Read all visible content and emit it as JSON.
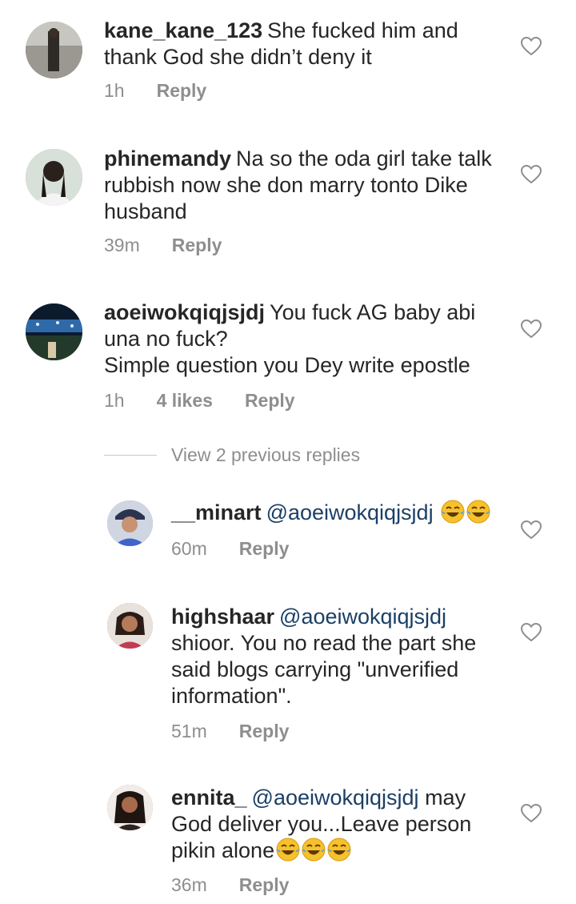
{
  "comments": [
    {
      "username": "kane_kane_123",
      "text": "She fucked him and thank God she didn’t deny it",
      "time": "1h",
      "reply_label": "Reply"
    },
    {
      "username": "phinemandy",
      "text": "Na so the oda girl take talk rubbish now she don marry tonto Dike husband",
      "time": "39m",
      "reply_label": "Reply"
    },
    {
      "username": "aoeiwokqiqjsjdj",
      "text_line1": "You fuck AG baby abi una no fuck?",
      "text_line2": "Simple question you Dey write epostle",
      "time": "1h",
      "likes": "4 likes",
      "reply_label": "Reply"
    }
  ],
  "view_previous_replies": "View 2 previous replies",
  "replies": [
    {
      "username": "__minart",
      "mention": "@aoeiwokqiqjsjdj",
      "text": "",
      "emoji_count": 2,
      "time": "60m",
      "reply_label": "Reply"
    },
    {
      "username": "highshaar",
      "mention": "@aoeiwokqiqjsjdj",
      "text": "shioor. You no read the part she said blogs carrying \"unverified information\".",
      "time": "51m",
      "reply_label": "Reply"
    },
    {
      "username": "ennita_",
      "mention": "@aoeiwokqiqjsjdj",
      "text": "may God deliver you...Leave person pikin alone",
      "emoji_count": 3,
      "time": "36m",
      "reply_label": "Reply"
    }
  ],
  "icons": {
    "like": "heart-outline-icon",
    "emoji": "face-with-tears-of-joy-icon"
  },
  "colors": {
    "text": "#262626",
    "meta": "#8e8e8e",
    "mention": "#1b3f66",
    "emoji": "#f7c12d"
  }
}
